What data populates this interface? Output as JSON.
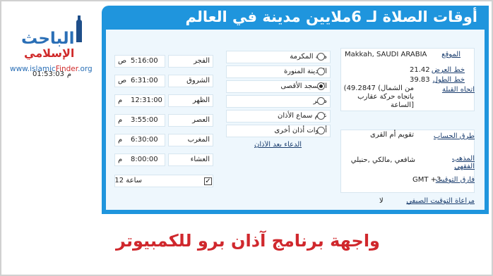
{
  "header": {
    "title": "أوقات الصلاة لـ 6ملايين مدينة في العالم"
  },
  "logo": {
    "line1": "الباحث",
    "line2": "الإسلامي",
    "url_prefix": "www.islamic",
    "url_red": "Finder",
    "url_suffix": ".org"
  },
  "clock": {
    "suffix": "م",
    "time": "01:53:03"
  },
  "prayers": [
    {
      "name": "الفجر",
      "suffix": "ص",
      "time": "5:16:00"
    },
    {
      "name": "الشروق",
      "suffix": "ص",
      "time": "6:31:00"
    },
    {
      "name": "الظهر",
      "suffix": "م",
      "time": "12:31:00"
    },
    {
      "name": "العصر",
      "suffix": "م",
      "time": "3:55:00"
    },
    {
      "name": "المغرب",
      "suffix": "م",
      "time": "6:30:00"
    },
    {
      "name": "العشاء",
      "suffix": "م",
      "time": "8:00:00"
    }
  ],
  "clock_format": {
    "label": "ساعة 12",
    "checked": true
  },
  "adhan_options": [
    {
      "label": "مكة المكرمة",
      "selected": false
    },
    {
      "label": "المدينة المنورة",
      "selected": false
    },
    {
      "label": "المسجد الأقصى",
      "selected": true
    },
    {
      "label": "مصر",
      "selected": false
    },
    {
      "label": "عدم سماع الأذان",
      "selected": false
    },
    {
      "label": "أصوات أذان أخرى",
      "selected": false
    }
  ],
  "dua_link": "الدعاء بعد الأذان",
  "location": {
    "location_label": "الموقع",
    "location_value": "Makkah, SAUDI ARABIA",
    "latitude_label": "خط العرض",
    "latitude_value": "21.42",
    "longitude_label": "خط الطول",
    "longitude_value": "39.83",
    "qibla_label": "اتجاه القبلة",
    "qibla_line1": "من الشمال) 49.2847)",
    "qibla_line2": "باتجاه حركة عقارب",
    "qibla_line3": "[الساعة"
  },
  "settings": {
    "calc_label": "طرق الحساب",
    "calc_value": "تقويم أم القرى",
    "madhab_label": "المذهب الفقهي",
    "madhab_value": "شافعي ,مالكي ,حنبلي",
    "timezone_label": "فارق التوقيت",
    "timezone_value": "GMT +3",
    "dst_label": "مراعاة التوقيت الصيفي",
    "dst_value": "لا"
  },
  "bottom_caption": "واجهة برنامج آذان برو للكمبيوتر"
}
